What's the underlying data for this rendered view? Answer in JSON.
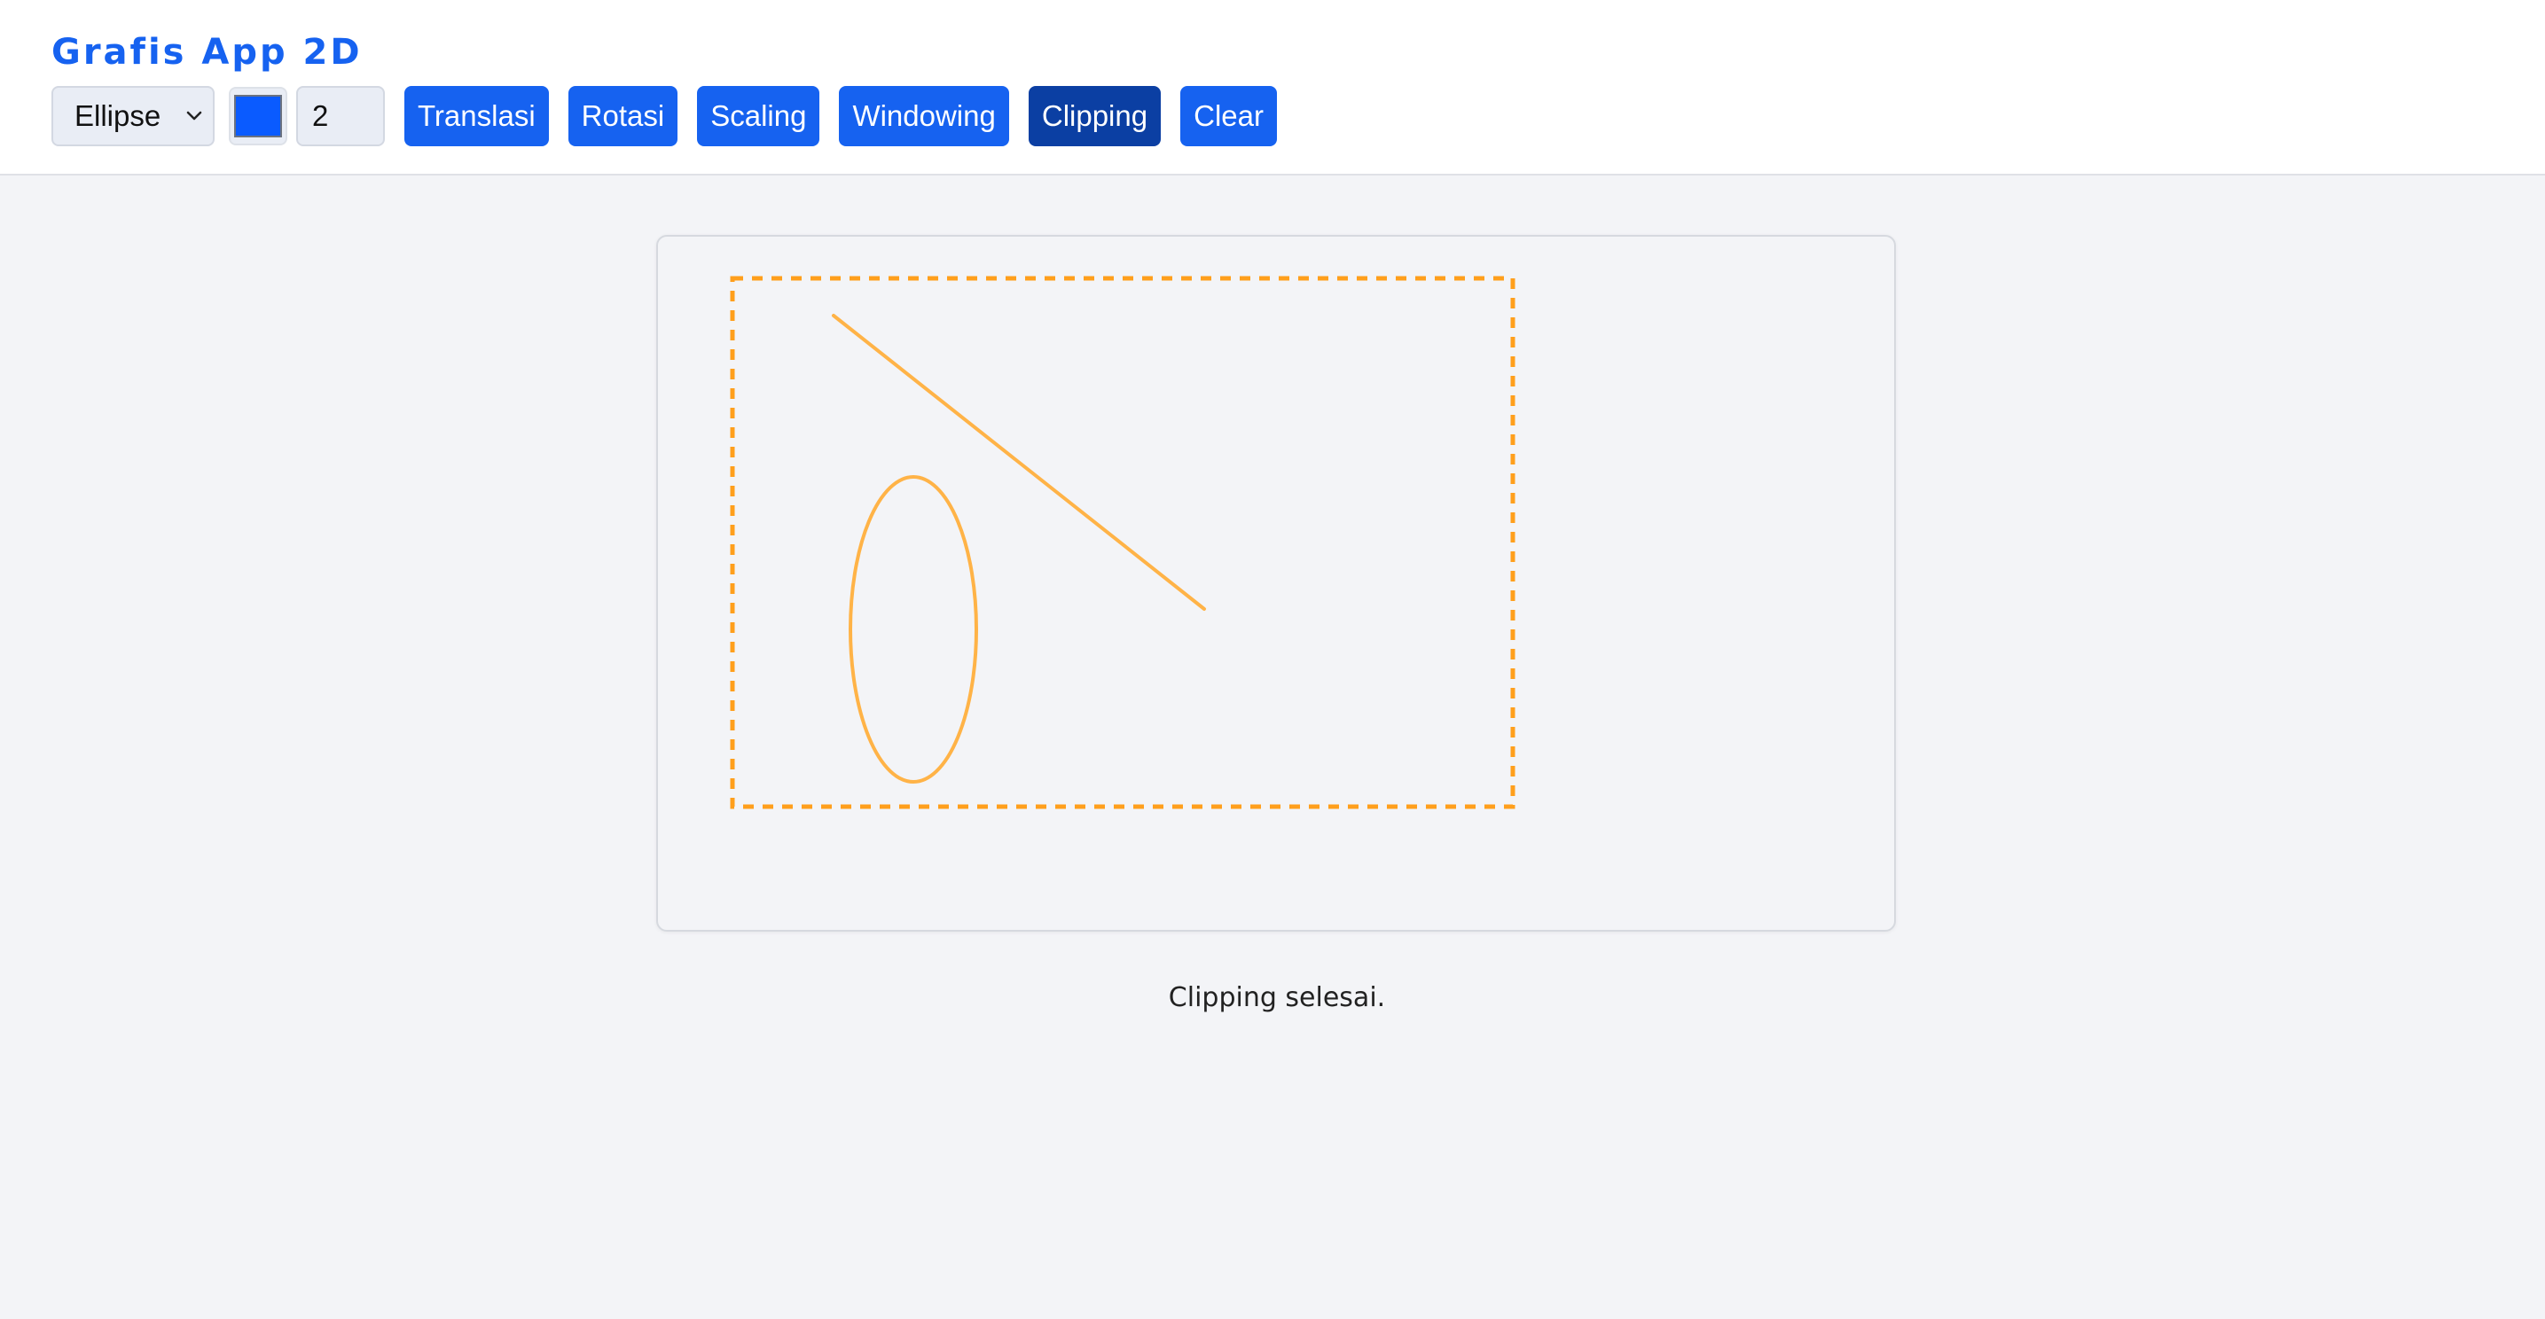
{
  "app": {
    "title": "Grafis App 2D"
  },
  "toolbar": {
    "shape_select": {
      "selected": "Ellipse"
    },
    "color_picker": {
      "value": "#0a5bff"
    },
    "stroke_width": {
      "value": "2"
    },
    "buttons": {
      "translasi": "Translasi",
      "rotasi": "Rotasi",
      "scaling": "Scaling",
      "windowing": "Windowing",
      "clipping": "Clipping",
      "clear": "Clear"
    },
    "active_button": "clipping"
  },
  "canvas": {
    "clip_window_color": "#ff9f1c",
    "shape_color": "#ffb347",
    "shapes": [
      {
        "type": "clip-window"
      },
      {
        "type": "line"
      },
      {
        "type": "ellipse"
      }
    ]
  },
  "status": {
    "message": "Clipping selesai."
  },
  "colors": {
    "accent": "#1662f0",
    "accent_active": "#0b3fa3",
    "background": "#f3f4f7",
    "header_bg": "#ffffff"
  }
}
